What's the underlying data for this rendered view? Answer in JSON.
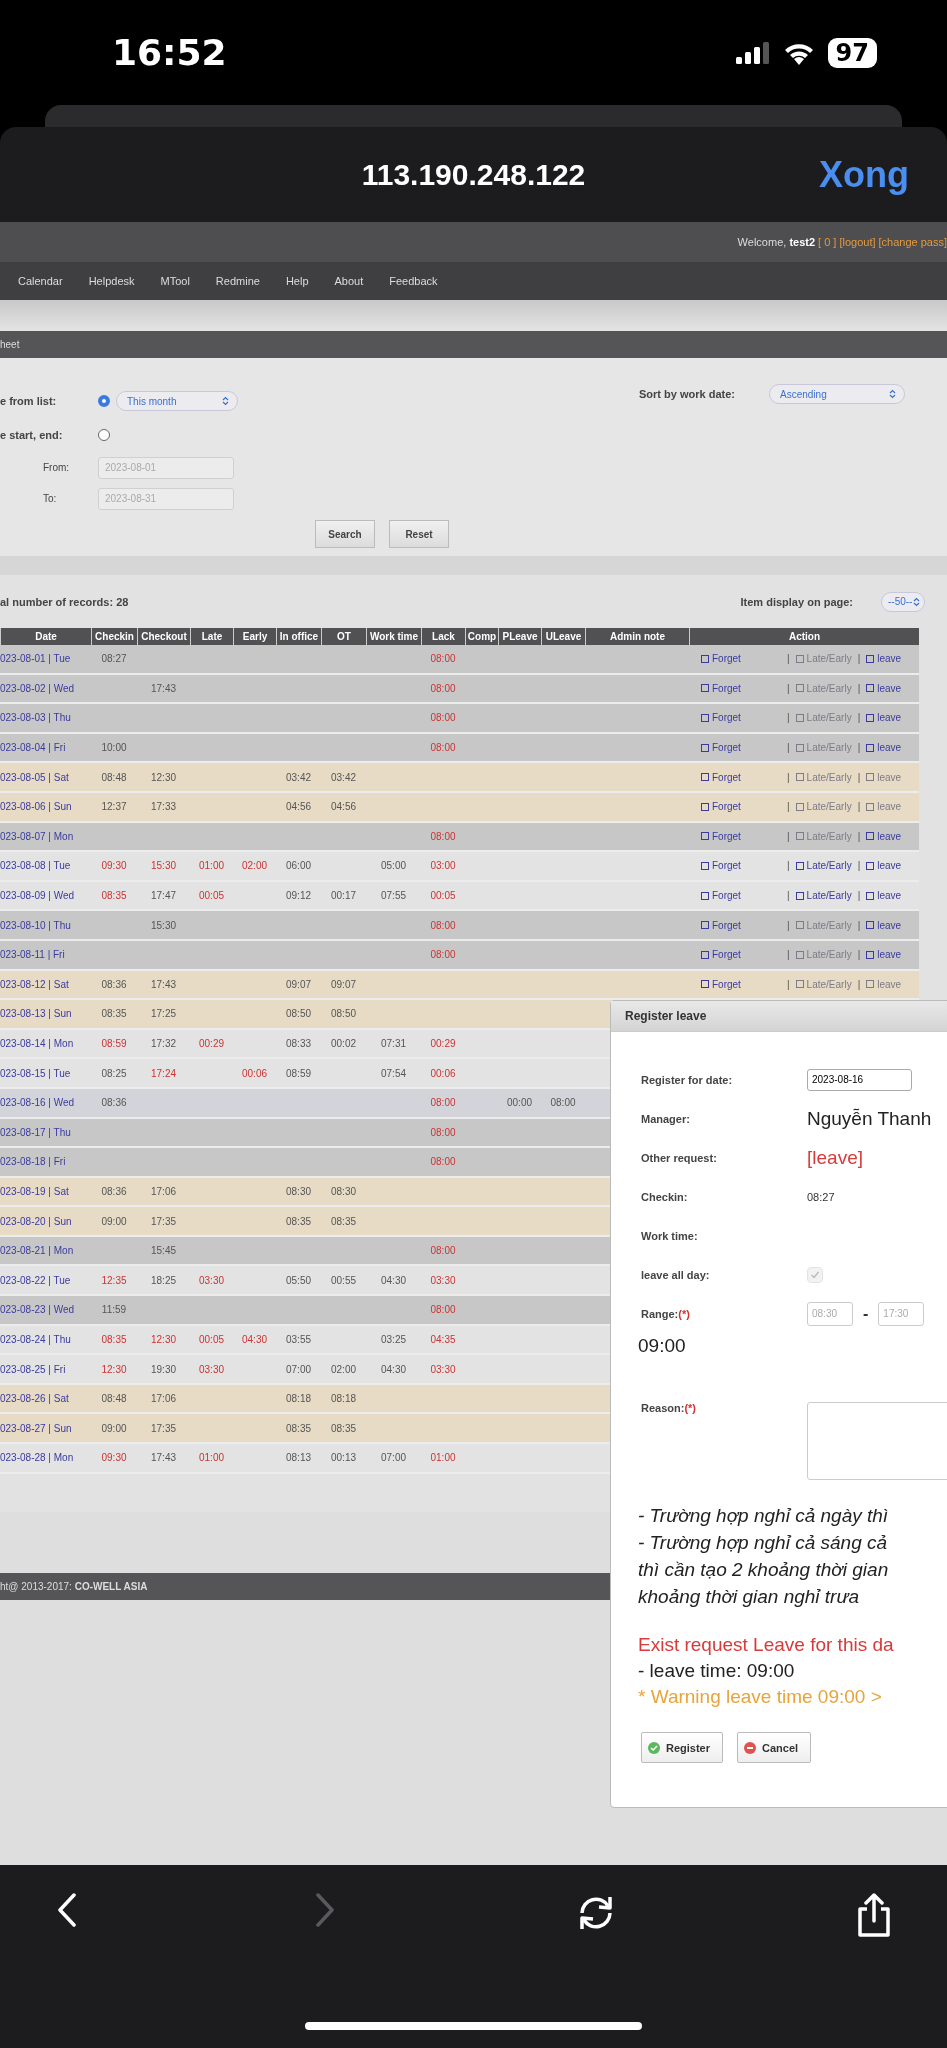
{
  "status_bar": {
    "time": "16:52",
    "battery": "97"
  },
  "browser": {
    "address": "113.190.248.122",
    "done": "Xong",
    "forward_disabled": true
  },
  "user_bar": {
    "greeting": "Welcome,",
    "user": "test2",
    "count": "[ 0 ]",
    "links": [
      "[logout]",
      "[change pass]"
    ]
  },
  "nav": [
    "Calendar",
    "Helpdesk",
    "MTool",
    "Redmine",
    "Help",
    "About",
    "Feedback"
  ],
  "page_title": "heet",
  "search_form": {
    "period": {
      "label": "e from list:",
      "selected": true,
      "value": "This month"
    },
    "custom_range": {
      "label": "e start, end:",
      "selected": false
    },
    "from": {
      "label": "From:",
      "value": "2023-08-01",
      "disabled": true
    },
    "to": {
      "label": "To:",
      "value": "2023-08-31",
      "disabled": true
    },
    "sort": {
      "label": "Sort by work date:",
      "value": "Ascending"
    },
    "buttons": [
      "Search",
      "Reset"
    ]
  },
  "records": {
    "total": "al number of records: 28",
    "page_size_label": "Item display on page:",
    "page_size": "--50--"
  },
  "table": {
    "columns": [
      "Date",
      "Checkin",
      "Checkout",
      "Late",
      "Early",
      "In office",
      "OT",
      "Work time",
      "Lack",
      "Comp",
      "PLeave",
      "ULeave",
      "Admin note",
      "Action"
    ],
    "action_separator": "|",
    "rows": [
      {
        "date": "023-08-01 | Tue",
        "kind": "absent",
        "selected": false,
        "checkin": "08:27",
        "checkin_late": false,
        "lack": "08:00",
        "actions": [
          {
            "label": "Forget",
            "disabled": false
          },
          {
            "label": "Late/Early",
            "disabled": true
          },
          {
            "label": "leave",
            "disabled": false
          }
        ]
      },
      {
        "date": "023-08-02 | Wed",
        "kind": "absent",
        "selected": false,
        "checkout": "17:43",
        "checkout_early": false,
        "lack": "08:00",
        "actions": [
          {
            "label": "Forget",
            "disabled": false
          },
          {
            "label": "Late/Early",
            "disabled": true
          },
          {
            "label": "leave",
            "disabled": false
          }
        ]
      },
      {
        "date": "023-08-03 | Thu",
        "kind": "absent",
        "selected": false,
        "lack": "08:00",
        "actions": [
          {
            "label": "Forget",
            "disabled": false
          },
          {
            "label": "Late/Early",
            "disabled": true
          },
          {
            "label": "leave",
            "disabled": false
          }
        ]
      },
      {
        "date": "023-08-04 | Fri",
        "kind": "absent",
        "selected": false,
        "checkin": "10:00",
        "checkin_late": false,
        "lack": "08:00",
        "actions": [
          {
            "label": "Forget",
            "disabled": false
          },
          {
            "label": "Late/Early",
            "disabled": true
          },
          {
            "label": "leave",
            "disabled": false
          }
        ]
      },
      {
        "date": "023-08-05 | Sat",
        "kind": "weekend",
        "selected": false,
        "checkin": "08:48",
        "checkout": "12:30",
        "checkin_late": false,
        "checkout_early": false,
        "in_office": "03:42",
        "ot": "03:42",
        "actions": [
          {
            "label": "Forget",
            "disabled": false
          },
          {
            "label": "Late/Early",
            "disabled": true
          },
          {
            "label": "leave",
            "disabled": true
          }
        ]
      },
      {
        "date": "023-08-06 | Sun",
        "kind": "weekend",
        "selected": false,
        "checkin": "12:37",
        "checkout": "17:33",
        "checkin_late": false,
        "checkout_early": false,
        "in_office": "04:56",
        "ot": "04:56",
        "actions": [
          {
            "label": "Forget",
            "disabled": false
          },
          {
            "label": "Late/Early",
            "disabled": true
          },
          {
            "label": "leave",
            "disabled": true
          }
        ]
      },
      {
        "date": "023-08-07 | Mon",
        "kind": "absent",
        "selected": false,
        "lack": "08:00",
        "actions": [
          {
            "label": "Forget",
            "disabled": false
          },
          {
            "label": "Late/Early",
            "disabled": true
          },
          {
            "label": "leave",
            "disabled": false
          }
        ]
      },
      {
        "date": "023-08-08 | Tue",
        "kind": "normal",
        "selected": false,
        "checkin": "09:30",
        "checkout": "15:30",
        "checkin_late": true,
        "checkout_early": true,
        "late": "01:00",
        "early": "02:00",
        "in_office": "06:00",
        "work_time": "05:00",
        "lack": "03:00",
        "actions": [
          {
            "label": "Forget",
            "disabled": false
          },
          {
            "label": "Late/Early",
            "disabled": false
          },
          {
            "label": "leave",
            "disabled": false
          }
        ]
      },
      {
        "date": "023-08-09 | Wed",
        "kind": "normal",
        "selected": false,
        "checkin": "08:35",
        "checkout": "17:47",
        "checkin_late": true,
        "checkout_early": false,
        "late": "00:05",
        "in_office": "09:12",
        "ot": "00:17",
        "work_time": "07:55",
        "lack": "00:05",
        "actions": [
          {
            "label": "Forget",
            "disabled": false
          },
          {
            "label": "Late/Early",
            "disabled": false
          },
          {
            "label": "leave",
            "disabled": false
          }
        ]
      },
      {
        "date": "023-08-10 | Thu",
        "kind": "absent",
        "selected": false,
        "checkout": "15:30",
        "checkout_early": false,
        "lack": "08:00",
        "actions": [
          {
            "label": "Forget",
            "disabled": false
          },
          {
            "label": "Late/Early",
            "disabled": true
          },
          {
            "label": "leave",
            "disabled": false
          }
        ]
      },
      {
        "date": "023-08-11 | Fri",
        "kind": "absent",
        "selected": false,
        "lack": "08:00",
        "actions": [
          {
            "label": "Forget",
            "disabled": false
          },
          {
            "label": "Late/Early",
            "disabled": true
          },
          {
            "label": "leave",
            "disabled": false
          }
        ]
      },
      {
        "date": "023-08-12 | Sat",
        "kind": "weekend",
        "selected": false,
        "checkin": "08:36",
        "checkout": "17:43",
        "checkin_late": false,
        "checkout_early": false,
        "in_office": "09:07",
        "ot": "09:07",
        "actions": [
          {
            "label": "Forget",
            "disabled": false
          },
          {
            "label": "Late/Early",
            "disabled": true
          },
          {
            "label": "leave",
            "disabled": true
          }
        ]
      },
      {
        "date": "023-08-13 | Sun",
        "kind": "weekend",
        "selected": false,
        "checkin": "08:35",
        "checkout": "17:25",
        "checkin_late": false,
        "checkout_early": false,
        "in_office": "08:50",
        "ot": "08:50"
      },
      {
        "date": "023-08-14 | Mon",
        "kind": "normal",
        "selected": false,
        "checkin": "08:59",
        "checkout": "17:32",
        "checkin_late": true,
        "checkout_early": false,
        "late": "00:29",
        "in_office": "08:33",
        "ot": "00:02",
        "work_time": "07:31",
        "lack": "00:29"
      },
      {
        "date": "023-08-15 | Tue",
        "kind": "normal",
        "selected": false,
        "checkin": "08:25",
        "checkout": "17:24",
        "checkin_late": false,
        "checkout_early": true,
        "early": "00:06",
        "in_office": "08:59",
        "work_time": "07:54",
        "lack": "00:06"
      },
      {
        "date": "023-08-16 | Wed",
        "kind": "absent",
        "selected": true,
        "checkin": "08:36",
        "checkin_late": false,
        "lack": "08:00",
        "pleave": "00:00",
        "uleave": "08:00"
      },
      {
        "date": "023-08-17 | Thu",
        "kind": "absent",
        "selected": false,
        "lack": "08:00"
      },
      {
        "date": "023-08-18 | Fri",
        "kind": "absent",
        "selected": false,
        "lack": "08:00"
      },
      {
        "date": "023-08-19 | Sat",
        "kind": "weekend",
        "selected": false,
        "checkin": "08:36",
        "checkout": "17:06",
        "checkin_late": false,
        "checkout_early": false,
        "in_office": "08:30",
        "ot": "08:30"
      },
      {
        "date": "023-08-20 | Sun",
        "kind": "weekend",
        "selected": false,
        "checkin": "09:00",
        "checkout": "17:35",
        "checkin_late": false,
        "checkout_early": false,
        "in_office": "08:35",
        "ot": "08:35"
      },
      {
        "date": "023-08-21 | Mon",
        "kind": "absent",
        "selected": false,
        "checkout": "15:45",
        "checkout_early": false,
        "lack": "08:00"
      },
      {
        "date": "023-08-22 | Tue",
        "kind": "normal",
        "selected": false,
        "checkin": "12:35",
        "checkout": "18:25",
        "checkin_late": true,
        "checkout_early": false,
        "late": "03:30",
        "in_office": "05:50",
        "ot": "00:55",
        "work_time": "04:30",
        "lack": "03:30"
      },
      {
        "date": "023-08-23 | Wed",
        "kind": "absent",
        "selected": false,
        "checkin": "11:59",
        "checkin_late": false,
        "lack": "08:00"
      },
      {
        "date": "023-08-24 | Thu",
        "kind": "normal",
        "selected": false,
        "checkin": "08:35",
        "checkout": "12:30",
        "checkin_late": true,
        "checkout_early": true,
        "late": "00:05",
        "early": "04:30",
        "in_office": "03:55",
        "work_time": "03:25",
        "lack": "04:35"
      },
      {
        "date": "023-08-25 | Fri",
        "kind": "normal",
        "selected": false,
        "checkin": "12:30",
        "checkout": "19:30",
        "checkin_late": true,
        "checkout_early": false,
        "late": "03:30",
        "in_office": "07:00",
        "ot": "02:00",
        "work_time": "04:30",
        "lack": "03:30"
      },
      {
        "date": "023-08-26 | Sat",
        "kind": "weekend",
        "selected": false,
        "checkin": "08:48",
        "checkout": "17:06",
        "checkin_late": false,
        "checkout_early": false,
        "in_office": "08:18",
        "ot": "08:18"
      },
      {
        "date": "023-08-27 | Sun",
        "kind": "weekend",
        "selected": false,
        "checkin": "09:00",
        "checkout": "17:35",
        "checkin_late": false,
        "checkout_early": false,
        "in_office": "08:35",
        "ot": "08:35"
      },
      {
        "date": "023-08-28 | Mon",
        "kind": "normal",
        "selected": false,
        "checkin": "09:30",
        "checkout": "17:43",
        "checkin_late": true,
        "checkout_early": false,
        "late": "01:00",
        "in_office": "08:13",
        "ot": "00:13",
        "work_time": "07:00",
        "lack": "01:00"
      }
    ]
  },
  "footer": {
    "copyright": "ht@ 2013-2017: **CO-WELL ASIA**"
  },
  "dialog": {
    "title": "Register leave",
    "fields": [
      {
        "kind": "input",
        "label": "Register for date:",
        "value": "2023-08-16"
      },
      {
        "kind": "name",
        "label": "Manager:",
        "value": "Nguyễn Thanh"
      },
      {
        "kind": "alert",
        "label": "Other request:",
        "value": "[leave]"
      },
      {
        "kind": "plain",
        "label": "Checkin:",
        "value": "08:27"
      },
      {
        "kind": "plain",
        "label": "Work time:"
      },
      {
        "kind": "checkbox",
        "label": "leave all day:",
        "checked": true,
        "disabled": true
      },
      {
        "kind": "range",
        "label": "Range:",
        "required_mark": "(*)",
        "from": "08:30",
        "to": "17:30",
        "separator": "-",
        "disabled": true
      }
    ],
    "range_total": "09:00",
    "reason": {
      "label": "Reason:",
      "required_mark": "(*)"
    },
    "notes": [
      "- Trường hợp nghỉ cả ngày thì",
      "- Trường hợp nghỉ cả sáng cả",
      "thì cần tạo 2 khoảng thời gian",
      "khoảng thời gian nghỉ trưa"
    ],
    "messages": [
      {
        "kind": "error",
        "text": "Exist request Leave for this da"
      },
      {
        "kind": "info",
        "text": "- leave time: 09:00"
      },
      {
        "kind": "warning",
        "text": "* Warning leave time 09:00 >"
      }
    ],
    "buttons": [
      {
        "kind": "confirm",
        "label": "Register"
      },
      {
        "kind": "cancel",
        "label": "Cancel"
      }
    ]
  }
}
